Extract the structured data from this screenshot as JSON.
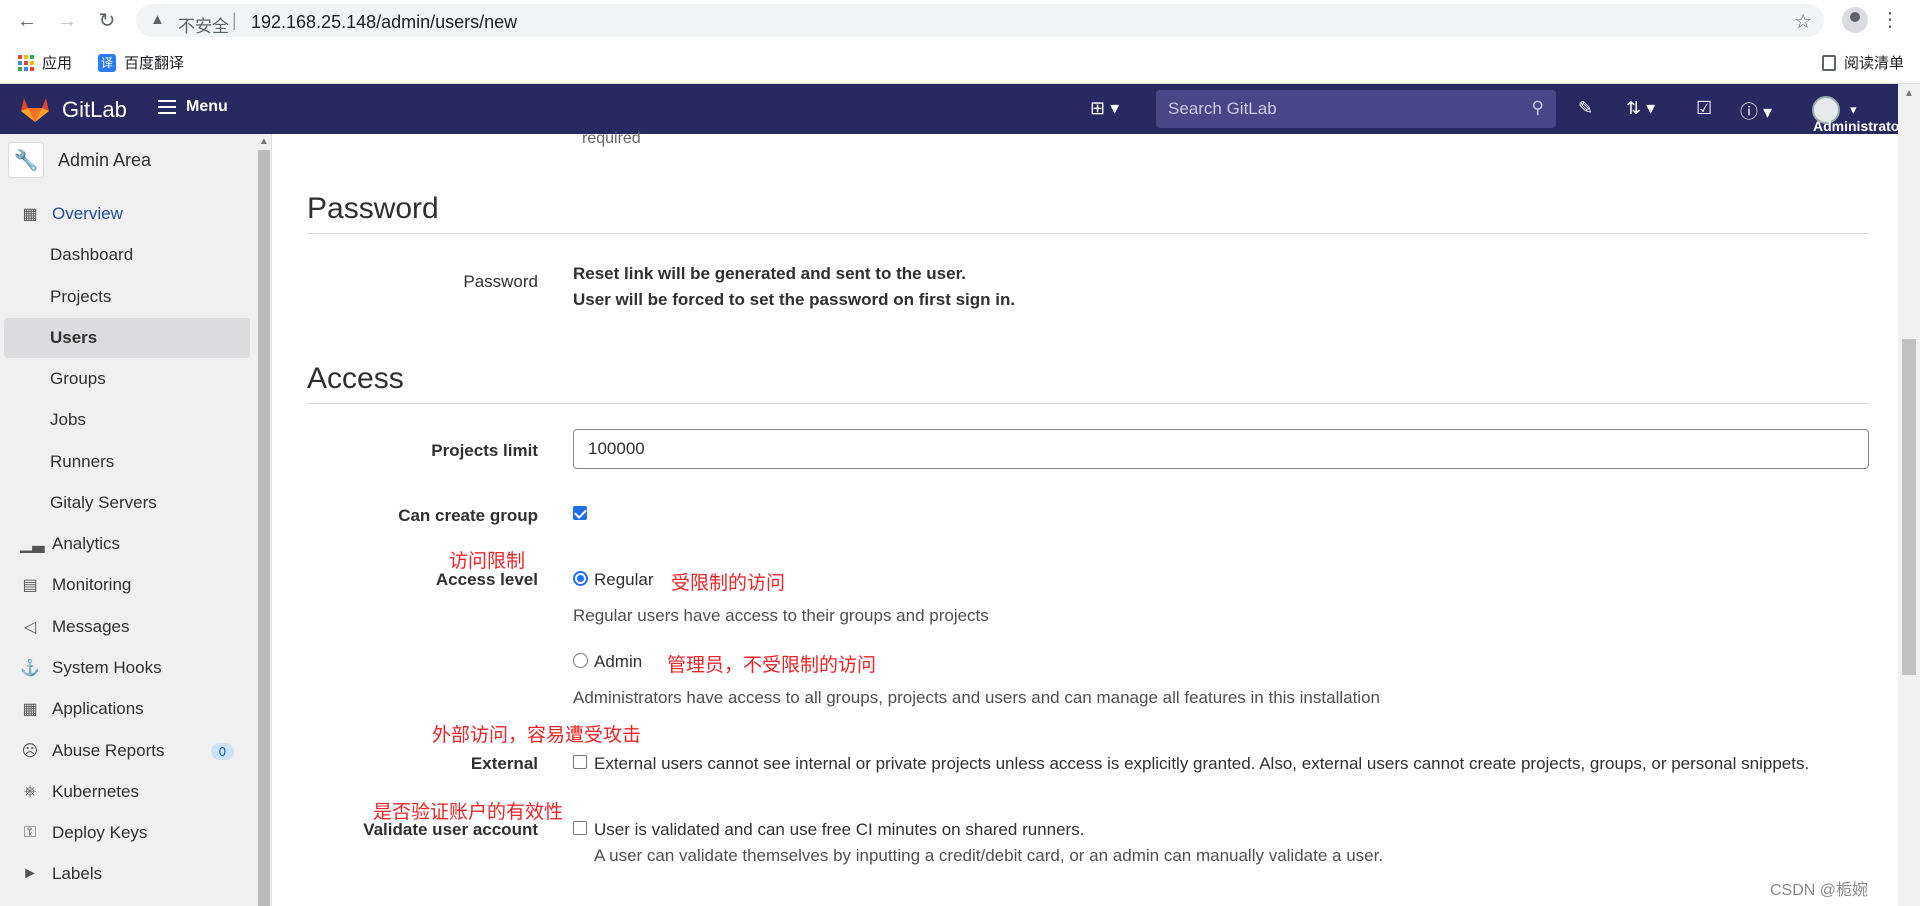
{
  "browser": {
    "insecure_label": "不安全",
    "url": "192.168.25.148/admin/users/new",
    "bookmarks": [
      {
        "label": "应用"
      },
      {
        "label": "百度翻译",
        "icon_text": "译"
      }
    ],
    "reading_list": "阅读清单"
  },
  "header": {
    "brand": "GitLab",
    "menu_label": "Menu",
    "search_placeholder": "Search GitLab",
    "user_label": "Administrato"
  },
  "sidebar": {
    "context_title": "Admin Area",
    "items": [
      {
        "label": "Overview",
        "icon": "grid-icon"
      },
      {
        "label": "Dashboard"
      },
      {
        "label": "Projects"
      },
      {
        "label": "Users"
      },
      {
        "label": "Groups"
      },
      {
        "label": "Jobs"
      },
      {
        "label": "Runners"
      },
      {
        "label": "Gitaly Servers"
      },
      {
        "label": "Analytics",
        "icon": "chart-icon"
      },
      {
        "label": "Monitoring",
        "icon": "monitor-icon"
      },
      {
        "label": "Messages",
        "icon": "bullhorn-icon"
      },
      {
        "label": "System Hooks",
        "icon": "hook-icon"
      },
      {
        "label": "Applications",
        "icon": "applications-icon"
      },
      {
        "label": "Abuse Reports",
        "icon": "sad-face-icon",
        "badge": "0"
      },
      {
        "label": "Kubernetes",
        "icon": "kubernetes-icon"
      },
      {
        "label": "Deploy Keys",
        "icon": "key-icon"
      },
      {
        "label": "Labels",
        "icon": "label-icon"
      }
    ]
  },
  "form": {
    "required_hint": "required",
    "password_section": {
      "title": "Password",
      "label": "Password",
      "line1": "Reset link will be generated and sent to the user.",
      "line2": "User will be forced to set the password on first sign in."
    },
    "access_section": {
      "title": "Access",
      "projects_limit_label": "Projects limit",
      "projects_limit_value": "100000",
      "can_create_group_label": "Can create group",
      "can_create_group_checked": true,
      "access_level_label": "Access level",
      "regular_label": "Regular",
      "regular_help": "Regular users have access to their groups and projects",
      "admin_label": "Admin",
      "admin_help": "Administrators have access to all groups, projects and users and can manage all features in this installation",
      "access_level_selected": "Regular",
      "external_label": "External",
      "external_help": "External users cannot see internal or private projects unless access is explicitly granted. Also, external users cannot create projects, groups, or personal snippets.",
      "external_checked": false,
      "validate_label": "Validate user account",
      "validate_help1": "User is validated and can use free CI minutes on shared runners.",
      "validate_help2": "A user can validate themselves by inputting a credit/debit card, or an admin can manually validate a user.",
      "validate_checked": false
    }
  },
  "annotations": {
    "access_limit": "访问限制",
    "regular_note": "受限制的访问",
    "admin_note": "管理员，不受限制的访问",
    "external_note": "外部访问，容易遭受攻击",
    "validate_note": "是否验证账户的有效性"
  },
  "watermark": "CSDN @栀婉",
  "colors": {
    "header_bg": "#292961",
    "accent": "#1f6feb",
    "annotation": "#e8262a"
  }
}
